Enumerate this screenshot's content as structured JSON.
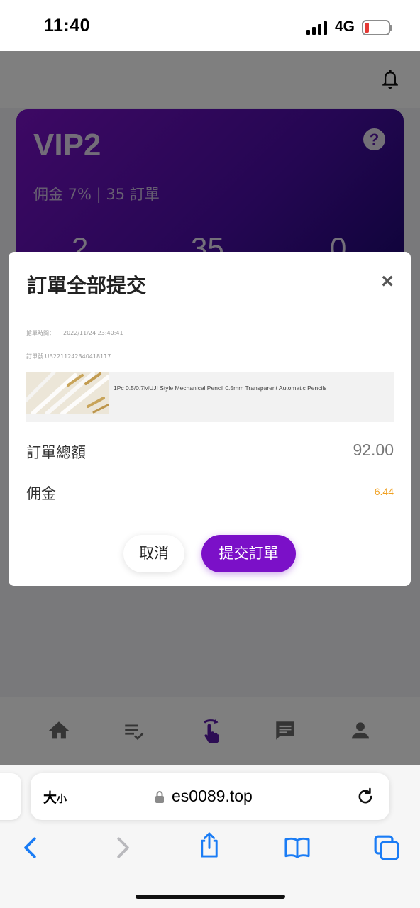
{
  "status_bar": {
    "time": "11:40",
    "network": "4G"
  },
  "vip_card": {
    "title": "VIP2",
    "help": "?",
    "subtitle": "佣金 7% | 35 訂單",
    "stats": [
      "2",
      "35",
      "0"
    ]
  },
  "bottom_nav": {
    "items": [
      "home-icon",
      "task-list-icon",
      "grab-order-icon",
      "chat-icon",
      "profile-icon"
    ],
    "active_color": "#5a1aa8"
  },
  "modal": {
    "title": "訂單全部提交",
    "close": "×",
    "order_time_label": "搶單時間：",
    "order_time": "2022/11/24 23:40:41",
    "order_no_label": "訂單號",
    "order_no": "UB2211242340418117",
    "product_name": "1Pc 0.5/0.7MUJI Style Mechanical Pencil 0.5mm Transparent Automatic Pencils",
    "total_label": "訂單總額",
    "total_value": "92.00",
    "commission_label": "佣金",
    "commission_value": "6.44",
    "cancel_label": "取消",
    "submit_label": "提交訂單",
    "accent_color": "#7b10c8"
  },
  "browser": {
    "text_size_big": "大",
    "text_size_small": "小",
    "url": "es0089.top",
    "toolbar": [
      "back-icon",
      "forward-icon",
      "share-icon",
      "bookmarks-icon",
      "tabs-icon"
    ]
  }
}
